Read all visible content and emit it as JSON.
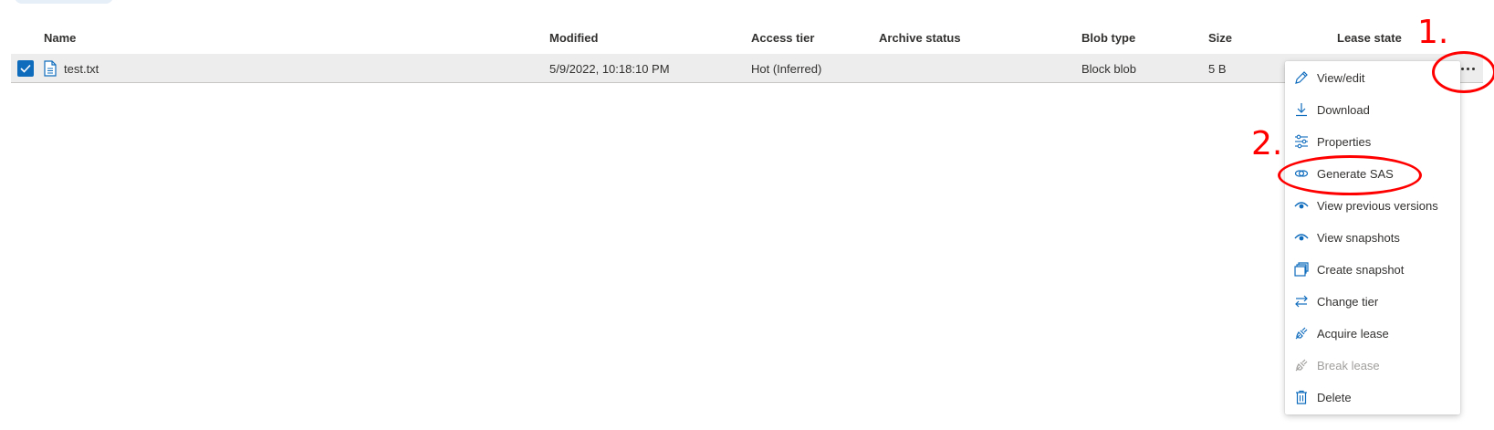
{
  "columns": {
    "name": "Name",
    "modified": "Modified",
    "access_tier": "Access tier",
    "archive_status": "Archive status",
    "blob_type": "Blob type",
    "size": "Size",
    "lease_state": "Lease state"
  },
  "row": {
    "name": "test.txt",
    "modified": "5/9/2022, 10:18:10 PM",
    "access_tier": "Hot (Inferred)",
    "archive_status": "",
    "blob_type": "Block blob",
    "size": "5 B",
    "lease_state": "",
    "selected": true
  },
  "context_menu": {
    "items": [
      {
        "label": "View/edit",
        "icon": "pencil-icon",
        "enabled": true
      },
      {
        "label": "Download",
        "icon": "download-icon",
        "enabled": true
      },
      {
        "label": "Properties",
        "icon": "properties-icon",
        "enabled": true
      },
      {
        "label": "Generate SAS",
        "icon": "link-icon",
        "enabled": true
      },
      {
        "label": "View previous versions",
        "icon": "eye-icon",
        "enabled": true
      },
      {
        "label": "View snapshots",
        "icon": "eye-icon",
        "enabled": true
      },
      {
        "label": "Create snapshot",
        "icon": "snapshot-icon",
        "enabled": true
      },
      {
        "label": "Change tier",
        "icon": "swap-arrows-icon",
        "enabled": true
      },
      {
        "label": "Acquire lease",
        "icon": "plug-icon",
        "enabled": true
      },
      {
        "label": "Break lease",
        "icon": "plug-icon",
        "enabled": false
      },
      {
        "label": "Delete",
        "icon": "trash-icon",
        "enabled": true
      }
    ]
  },
  "annotations": {
    "step1": "1.",
    "step2": "2."
  },
  "colors": {
    "accent": "#0f6cbd",
    "annotation": "#ff0000",
    "row_selected": "#ededed",
    "disabled_text": "#a19f9d"
  }
}
